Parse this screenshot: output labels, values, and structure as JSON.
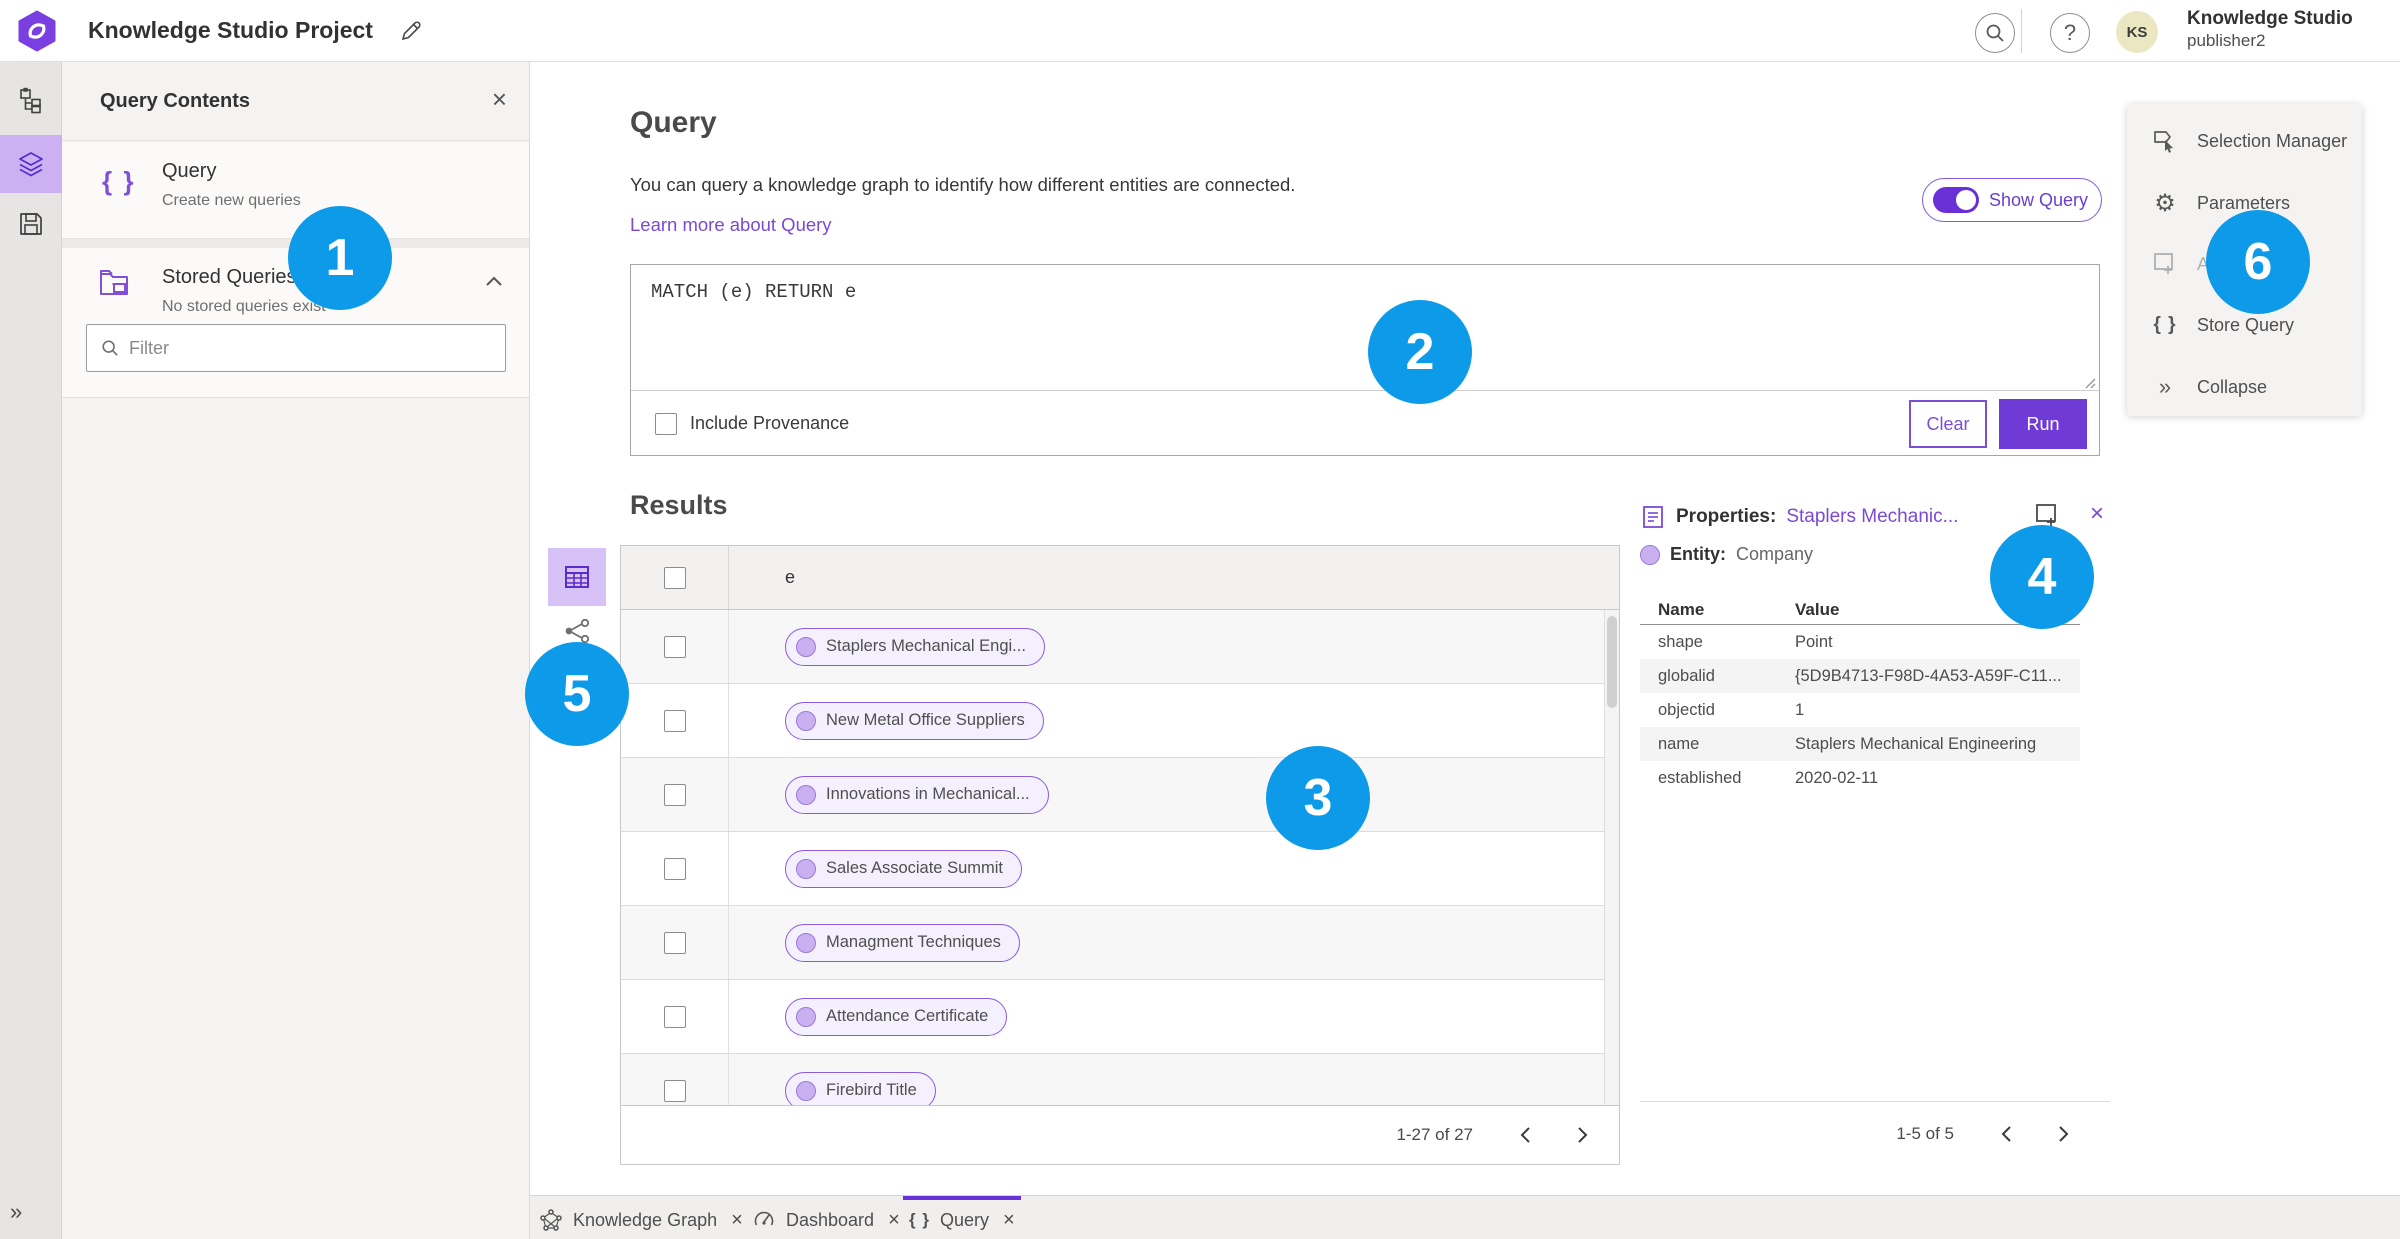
{
  "topbar": {
    "app_title": "Knowledge Studio Project",
    "user_org": "Knowledge Studio",
    "user_name": "publisher2",
    "avatar_initials": "KS"
  },
  "query_contents": {
    "title": "Query Contents",
    "items": [
      {
        "label": "Query",
        "sublabel": "Create new queries"
      },
      {
        "label": "Stored Queries",
        "sublabel": "No stored queries exist"
      }
    ],
    "filter_placeholder": "Filter"
  },
  "query_panel": {
    "title": "Query",
    "description": "You can query a knowledge graph to identify how different entities are connected.",
    "learn_more": "Learn more about Query",
    "show_query_label": "Show Query",
    "query_text": "MATCH (e) RETURN e",
    "include_provenance_label": "Include Provenance",
    "clear_label": "Clear",
    "run_label": "Run"
  },
  "results": {
    "title": "Results",
    "column_header": "e",
    "rows": [
      "Staplers Mechanical Engi...",
      "New Metal Office Suppliers",
      "Innovations in Mechanical...",
      "Sales Associate Summit",
      "Managment Techniques",
      "Attendance Certificate",
      "Firebird Title"
    ],
    "pagination": "1-27 of 27"
  },
  "properties": {
    "title": "Properties:",
    "entity_link": "Staplers Mechanic...",
    "entity_label": "Entity:",
    "entity_type": "Company",
    "col_name": "Name",
    "col_value": "Value",
    "rows": [
      {
        "name": "shape",
        "value": "Point"
      },
      {
        "name": "globalid",
        "value": "{5D9B4713-F98D-4A53-A59F-C11..."
      },
      {
        "name": "objectid",
        "value": "1"
      },
      {
        "name": "name",
        "value": "Staplers Mechanical Engineering"
      },
      {
        "name": "established",
        "value": "2020-02-11"
      }
    ],
    "pagination": "1-5 of 5"
  },
  "actions_panel": {
    "items": [
      {
        "label": "Selection Manager"
      },
      {
        "label": "Parameters"
      },
      {
        "label": "Ad"
      },
      {
        "label": "Store Query"
      },
      {
        "label": "Collapse"
      }
    ]
  },
  "tabs": [
    {
      "label": "Knowledge Graph"
    },
    {
      "label": "Dashboard"
    },
    {
      "label": "Query"
    }
  ],
  "badges": {
    "b1": "1",
    "b2": "2",
    "b3": "3",
    "b4": "4",
    "b5": "5",
    "b6": "6"
  },
  "icons": {
    "braces": "{ }",
    "close": "×",
    "collapse": "»",
    "gear": "⚙",
    "help": "?",
    "expand_rail": "»"
  },
  "colors": {
    "accent_purple": "#6a30d8",
    "link_purple": "#7a49d6",
    "badge_blue": "#0d9be9",
    "rail_active_bg": "#cbb1f2",
    "pill_bg": "#f5f0fd",
    "pill_border": "#8a5cdf"
  }
}
